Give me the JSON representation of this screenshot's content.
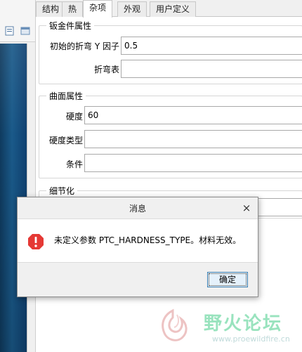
{
  "tabs": [
    {
      "label": "结构"
    },
    {
      "label": "热"
    },
    {
      "label": "杂项"
    },
    {
      "label": "外观"
    },
    {
      "label": "用户定义"
    }
  ],
  "active_tab": "杂项",
  "sheetmetal": {
    "title": "钣金件属性",
    "y_factor_label": "初始的折弯 Y 因子",
    "y_factor_value": "0.5",
    "bend_table_label": "折弯表",
    "bend_table_value": ""
  },
  "surface": {
    "title": "曲面属性",
    "hardness_label": "硬度",
    "hardness_value": "60",
    "hardness_type_label": "硬度类型",
    "hardness_type_value": "",
    "condition_label": "条件",
    "condition_value": ""
  },
  "detail": {
    "title": "细节化"
  },
  "dialog": {
    "title": "消息",
    "close_glyph": "×",
    "message": "未定义参数 PTC_HARDNESS_TYPE。材料无效。",
    "ok_label": "确定",
    "icon": "error-icon"
  },
  "watermark": {
    "text": "野火论坛",
    "url": "www.proewildfire.cn"
  },
  "colors": {
    "error": "#e53935",
    "accent": "#3c7fb1",
    "watermark_text": "#8fe0b8"
  }
}
